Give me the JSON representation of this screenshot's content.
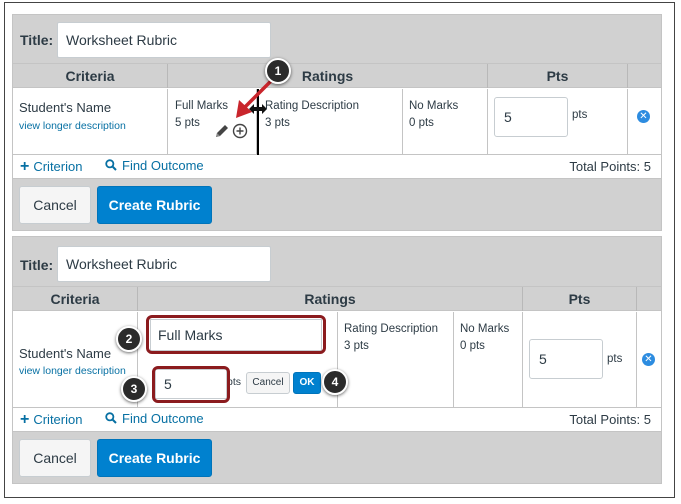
{
  "top": {
    "title_label": "Title:",
    "title_value": "Worksheet Rubric",
    "headers": {
      "criteria": "Criteria",
      "ratings": "Ratings",
      "pts": "Pts"
    },
    "criterion": {
      "name": "Student's Name",
      "link": "view longer description"
    },
    "ratings": [
      {
        "title": "Full Marks",
        "pts": "5 pts"
      },
      {
        "title": "Rating Description",
        "pts": "3 pts"
      },
      {
        "title": "No Marks",
        "pts": "0 pts"
      }
    ],
    "points_value": "5",
    "points_unit": "pts",
    "add_criterion": "Criterion",
    "find_outcome": "Find Outcome",
    "total": "Total Points: 5",
    "cancel": "Cancel",
    "create": "Create Rubric",
    "callout": "1"
  },
  "bottom": {
    "title_label": "Title:",
    "title_value": "Worksheet Rubric",
    "headers": {
      "criteria": "Criteria",
      "ratings": "Ratings",
      "pts": "Pts"
    },
    "criterion": {
      "name": "Student's Name",
      "link": "view longer description"
    },
    "edit_title_value": "Full Marks",
    "edit_pts_value": "5",
    "edit_pts_unit": "pts",
    "edit_cancel": "Cancel",
    "edit_ok": "OK",
    "ratings": [
      {
        "title": "Rating Description",
        "pts": "3 pts"
      },
      {
        "title": "No Marks",
        "pts": "0 pts"
      }
    ],
    "points_value": "5",
    "points_unit": "pts",
    "add_criterion": "Criterion",
    "find_outcome": "Find Outcome",
    "total": "Total Points: 5",
    "cancel": "Cancel",
    "create": "Create Rubric",
    "callouts": [
      "2",
      "3",
      "4"
    ]
  },
  "colors": {
    "accent": "#0081cf",
    "link": "#0770a3",
    "highlight": "#8b1b1e",
    "header_bg": "#d1d1d1",
    "arrow": "#c9252c"
  },
  "icons": [
    "pencil-icon",
    "plus-circle-icon",
    "resize-arrows-icon",
    "remove-icon",
    "plus-icon",
    "search-icon"
  ]
}
